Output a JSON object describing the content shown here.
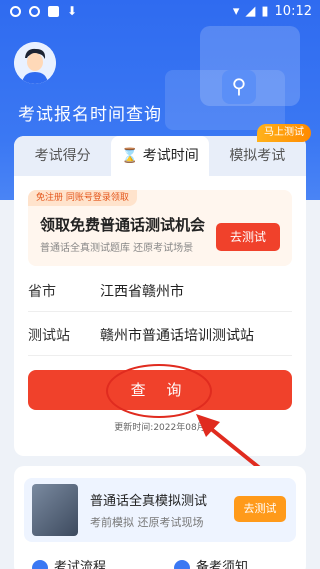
{
  "status_bar": {
    "time": "10:12"
  },
  "header": {
    "title": "考试报名时间查询"
  },
  "badge": "马上测试",
  "tabs": [
    {
      "label": "考试得分"
    },
    {
      "label": "考试时间",
      "active": true
    },
    {
      "label": "模拟考试"
    }
  ],
  "promo": {
    "tag": "免注册 同账号登录领取",
    "title": "领取免费普通话测试机会",
    "subtitle": "普通话全真测试题库 还原考试场景",
    "button": "去测试"
  },
  "form": {
    "province_label": "省市",
    "province_value": "江西省赣州市",
    "site_label": "测试站",
    "site_value": "赣州市普通话培训测试站"
  },
  "query_button": "查 询",
  "update_text": "更新时间:2022年08月",
  "simulation": {
    "title": "普通话全真模拟测试",
    "subtitle": "考前模拟 还原考试现场",
    "button": "去测试"
  },
  "bottom_items": [
    {
      "label": "考试流程"
    },
    {
      "label": "备考须知"
    }
  ],
  "colors": {
    "primary": "#3b78f3",
    "accent": "#f0412b",
    "orange": "#ff9a1a"
  }
}
